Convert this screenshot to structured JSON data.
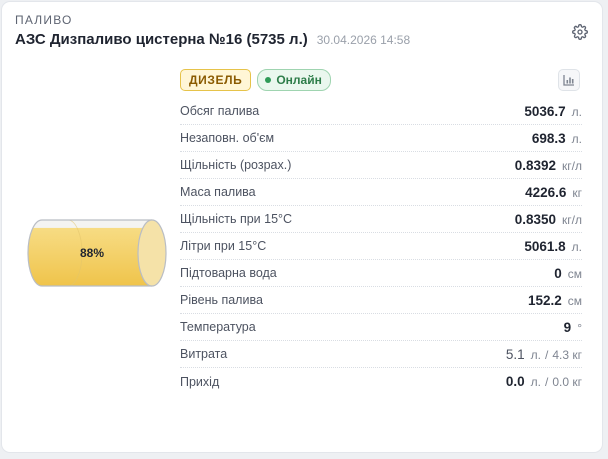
{
  "section": "ПАЛИВО",
  "title": "АЗС Дизпаливо цистерна №16 (5735 л.)",
  "timestamp": "30.04.2026 14:58",
  "icons": {
    "settings": "gear-icon",
    "chart": "bar-chart-icon"
  },
  "tank": {
    "percent_text": "88%",
    "fill_fraction": 0.88
  },
  "badges": {
    "fuel": "ДИЗЕЛЬ",
    "status": "Онлайн"
  },
  "colors": {
    "fuel_fill": "#f3c94f",
    "online": "#2e9a57",
    "fuel_badge_border": "#e6c34a"
  },
  "rows": [
    {
      "label": "Обсяг палива",
      "value": "5036.7",
      "unit": "л."
    },
    {
      "label": "Незаповн. об'єм",
      "value": "698.3",
      "unit": "л."
    },
    {
      "label": "Щільність (розрах.)",
      "value": "0.8392",
      "unit": "кг/л"
    },
    {
      "label": "Маса палива",
      "value": "4226.6",
      "unit": "кг"
    },
    {
      "label": "Щільність при 15°C",
      "value": "0.8350",
      "unit": "кг/л"
    },
    {
      "label": "Літри при 15°C",
      "value": "5061.8",
      "unit": "л."
    },
    {
      "label": "Підтоварна вода",
      "value": "0",
      "unit": "см"
    },
    {
      "label": "Рівень палива",
      "value": "152.2",
      "unit": "см"
    },
    {
      "label": "Температура",
      "value": "9",
      "unit": "°"
    }
  ],
  "consumption": {
    "label": "Витрата",
    "value": "5.1",
    "unit": "л.",
    "separator": "/",
    "secondary": "4.3 кг"
  },
  "income": {
    "label": "Прихід",
    "value": "0.0",
    "unit": "л.",
    "separator": "/",
    "secondary": "0.0 кг"
  }
}
